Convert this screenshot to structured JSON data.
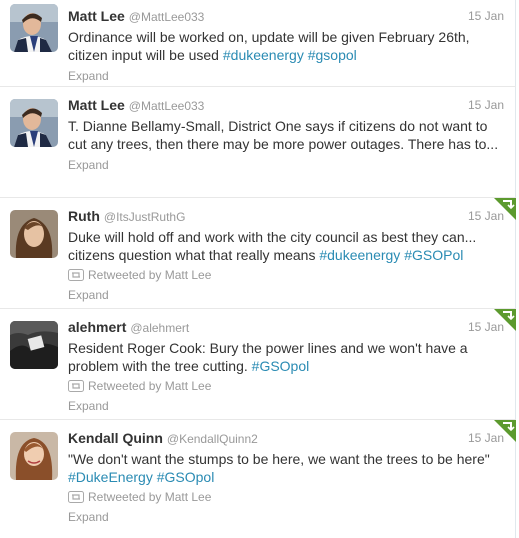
{
  "tweets": [
    {
      "fullname": "Matt Lee",
      "username": "@MattLee033",
      "time": "15 Jan",
      "text_parts": [
        "Ordinance will be worked on, update will be given February 26th, citizen input will be used ",
        "#dukeenergy",
        " ",
        "#gsopol"
      ],
      "expand": "Expand"
    },
    {
      "fullname": "Matt Lee",
      "username": "@MattLee033",
      "time": "15 Jan",
      "text_parts": [
        "T. Dianne Bellamy-Small, District One says if citizens do not want to cut any trees, then there may be more power outages. There has to..."
      ],
      "expand": "Expand"
    },
    {
      "fullname": "Ruth",
      "username": "@ItsJustRuthG",
      "time": "15 Jan",
      "text_parts": [
        "Duke will hold off and work with the city council as best they can... citizens question what that really means ",
        "#dukeenergy",
        " ",
        "#GSOPol"
      ],
      "retweeted": "Retweeted by Matt Lee",
      "expand": "Expand"
    },
    {
      "fullname": "alehmert",
      "username": "@alehmert",
      "time": "15 Jan",
      "text_parts": [
        "Resident Roger Cook: Bury the power lines and we won't have a problem with the tree cutting. ",
        "#GSOpol"
      ],
      "retweeted": "Retweeted by Matt Lee",
      "expand": "Expand"
    },
    {
      "fullname": "Kendall Quinn",
      "username": "@KendallQuinn2",
      "time": "15 Jan",
      "text_parts": [
        "\"We don't want the stumps to be here, we want the trees to be here\" ",
        "#DukeEnergy",
        " ",
        "#GSOpol"
      ],
      "retweeted": "Retweeted by Matt Lee",
      "expand": "Expand"
    }
  ],
  "colors": {
    "hashtag": "#2a8bb3",
    "retweet_corner": "#5c9a2e",
    "muted": "#999999",
    "text": "#333333"
  },
  "icons": {
    "retweet": "retweet-icon",
    "retweeted_corner": "retweeted-corner-icon"
  }
}
